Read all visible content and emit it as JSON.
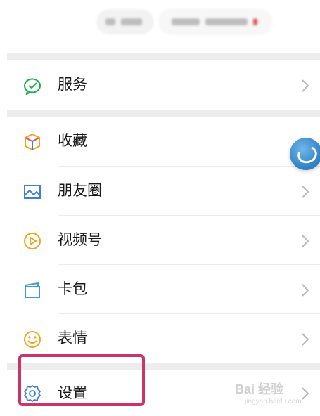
{
  "menu": {
    "items": [
      {
        "label": "服务",
        "icon": "wechat-pay-icon"
      },
      {
        "label": "收藏",
        "icon": "cube-icon"
      },
      {
        "label": "朋友圈",
        "icon": "image-icon"
      },
      {
        "label": "视频号",
        "icon": "play-circle-icon"
      },
      {
        "label": "卡包",
        "icon": "card-wallet-icon"
      },
      {
        "label": "表情",
        "icon": "smile-icon"
      },
      {
        "label": "设置",
        "icon": "gear-icon"
      }
    ]
  },
  "watermark": {
    "text": "Bai 经验",
    "sub": "jingyan.baidu.com"
  },
  "colors": {
    "highlight": "#cc3366",
    "green": "#19ad4b",
    "blue": "#3d7fd9",
    "yellow": "#f2a21b"
  }
}
